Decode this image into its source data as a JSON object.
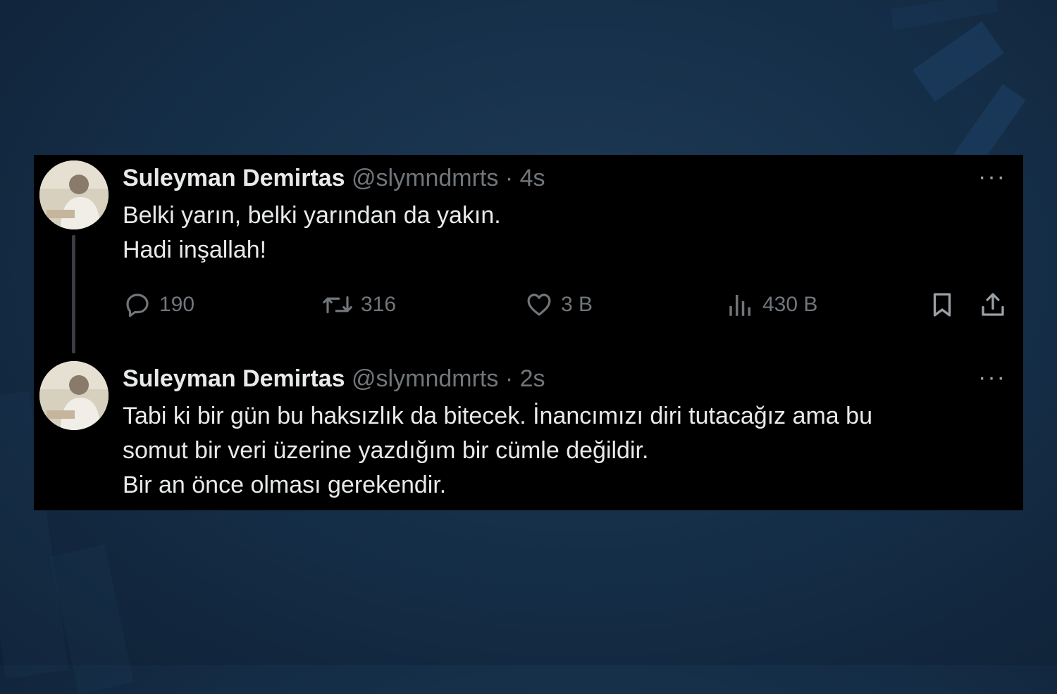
{
  "tweets": [
    {
      "name": "Suleyman Demirtas",
      "handle": "@slymndmrts",
      "separator": "·",
      "time": "4s",
      "more_label": "···",
      "lines": [
        "Belki yarın, belki yarından da yakın.",
        "Hadi inşallah!"
      ],
      "actions": {
        "reply": {
          "icon": "reply-icon",
          "count": "190"
        },
        "retweet": {
          "icon": "retweet-icon",
          "count": "316"
        },
        "like": {
          "icon": "heart-icon",
          "count": "3 B"
        },
        "views": {
          "icon": "views-icon",
          "count": "430 B"
        },
        "bookmark": {
          "icon": "bookmark-icon"
        },
        "share": {
          "icon": "share-icon"
        }
      }
    },
    {
      "name": "Suleyman Demirtas",
      "handle": "@slymndmrts",
      "separator": "·",
      "time": "2s",
      "more_label": "···",
      "lines": [
        "Tabi ki bir gün bu haksızlık da bitecek. İnancımızı diri tutacağız ama bu",
        "somut bir veri üzerine yazdığım bir cümle değildir.",
        "Bir an önce olması gerekendir."
      ]
    }
  ],
  "colors": {
    "card_background": "#000000",
    "primary_text": "#e7e9ea",
    "secondary_text": "#71767b",
    "page_background": "#16304a"
  }
}
